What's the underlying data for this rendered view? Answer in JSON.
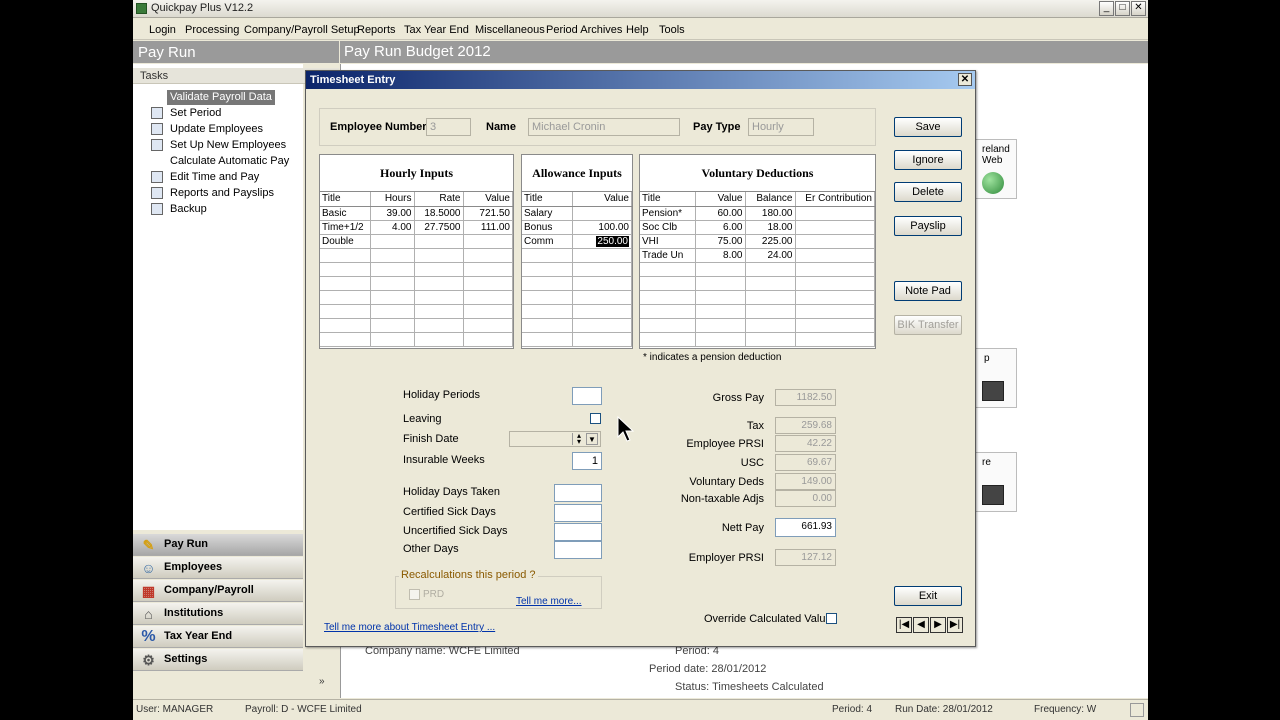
{
  "window": {
    "title": "Quickpay Plus V12.2"
  },
  "menu": [
    "Login",
    "Processing",
    "Company/Payroll Setup",
    "Reports",
    "Tax Year End",
    "Miscellaneous",
    "Period Archives",
    "Help",
    "Tools"
  ],
  "left_header": "Pay Run",
  "main_header": "Pay Run Budget 2012",
  "tasks": {
    "heading": "Tasks",
    "items": [
      "Validate Payroll Data",
      "Set Period",
      "Update Employees",
      "Set Up New Employees",
      "Calculate Automatic Pay",
      "Edit Time and Pay",
      "Reports and Payslips",
      "Backup"
    ]
  },
  "nav": [
    "Pay Run",
    "Employees",
    "Company/Payroll",
    "Institutions",
    "Tax Year End",
    "Settings"
  ],
  "tiles": [
    "reland Web",
    "p",
    "re"
  ],
  "info": {
    "company": "Company name:  WCFE Limited",
    "period": "Period:  4",
    "period_date": "Period date:  28/01/2012",
    "status": "Status:  Timesheets Calculated"
  },
  "statusbar": {
    "user": "User: MANAGER",
    "payroll": "Payroll: D - WCFE Limited",
    "period": "Period:  4",
    "run_date": "Run Date: 28/01/2012",
    "frequency": "Frequency: W"
  },
  "dialog": {
    "title": "Timesheet Entry",
    "employee_number_label": "Employee Number",
    "employee_number": "3",
    "name_label": "Name",
    "name": "Michael Cronin",
    "pay_type_label": "Pay Type",
    "pay_type": "Hourly",
    "hourly": {
      "title": "Hourly Inputs",
      "headers": [
        "Title",
        "Hours",
        "Rate",
        "Value"
      ],
      "rows": [
        [
          "Basic",
          "39.00",
          "18.5000",
          "721.50"
        ],
        [
          "Time+1/2",
          "4.00",
          "27.7500",
          "111.00"
        ],
        [
          "Double",
          "",
          "",
          ""
        ]
      ]
    },
    "allowance": {
      "title": "Allowance Inputs",
      "headers": [
        "Title",
        "Value"
      ],
      "rows": [
        [
          "Salary",
          ""
        ],
        [
          "Bonus",
          "100.00"
        ],
        [
          "Comm",
          "250.00"
        ]
      ]
    },
    "voluntary": {
      "title": "Voluntary Deductions",
      "headers": [
        "Title",
        "Value",
        "Balance",
        "Er Contribution"
      ],
      "rows": [
        [
          "Pension*",
          "60.00",
          "180.00",
          ""
        ],
        [
          "Soc Clb",
          "6.00",
          "18.00",
          ""
        ],
        [
          "VHI",
          "75.00",
          "225.00",
          ""
        ],
        [
          "Trade Un",
          "8.00",
          "24.00",
          ""
        ]
      ]
    },
    "pension_note": "* indicates a pension deduction",
    "buttons": [
      "Save",
      "Ignore",
      "Delete",
      "Payslip",
      "Note Pad",
      "BIK Transfer",
      "Exit"
    ],
    "left_fields": {
      "holiday_periods": "Holiday Periods",
      "leaving": "Leaving",
      "finish_date": "Finish Date",
      "insurable_weeks": "Insurable Weeks",
      "insurable_weeks_value": "1",
      "holiday_days_taken": "Holiday Days Taken",
      "certified_sick_days": "Certified Sick Days",
      "uncertified_sick_days": "Uncertified Sick Days",
      "other_days": "Other Days"
    },
    "recalc": {
      "legend": "Recalculations this period ?",
      "prd": "PRD",
      "link": "Tell me more..."
    },
    "totals": [
      {
        "label": "Gross Pay",
        "value": "1182.50"
      },
      {
        "label": "Tax",
        "value": "259.68"
      },
      {
        "label": "Employee PRSI",
        "value": "42.22"
      },
      {
        "label": "USC",
        "value": "69.67"
      },
      {
        "label": "Voluntary Deds",
        "value": "149.00"
      },
      {
        "label": "Non-taxable Adjs",
        "value": "0.00"
      },
      {
        "label": "Nett Pay",
        "value": "661.93"
      },
      {
        "label": "Employer PRSI",
        "value": "127.12"
      }
    ],
    "override_label": "Override Calculated Values",
    "tell_me_link": "Tell me more about Timesheet Entry ...",
    "record_nav": [
      "|◀",
      "◀",
      "▶",
      "▶|"
    ]
  },
  "colors": {
    "dialog_title_start": "#0b246a",
    "dialog_title_end": "#a6caf0",
    "header_band": "#9a9a9a"
  }
}
